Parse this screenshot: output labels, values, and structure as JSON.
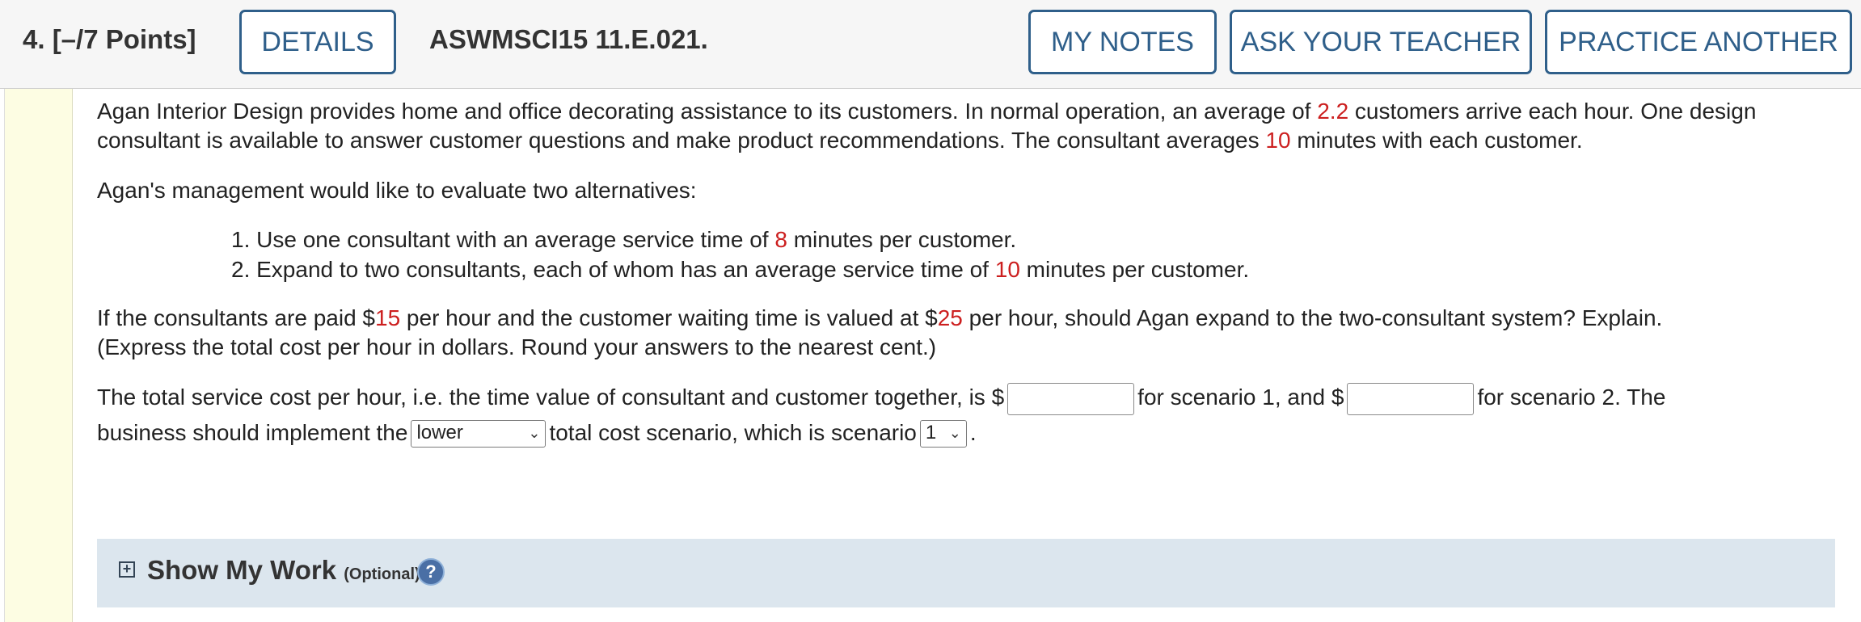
{
  "header": {
    "question_label": "4.  [–/7 Points]",
    "details_label": "DETAILS",
    "problem_code": "ASWMSCI15 11.E.021.",
    "my_notes_label": "MY NOTES",
    "ask_teacher_label": "ASK YOUR TEACHER",
    "practice_another_label": "PRACTICE ANOTHER"
  },
  "body": {
    "p1_a": "Agan Interior Design provides home and office decorating assistance to its customers. In normal operation, an average of ",
    "p1_rate": "2.2",
    "p1_b": " customers arrive each hour. One design consultant is available to answer customer questions and make product recommendations. The consultant averages ",
    "p1_minutes": "10",
    "p1_c": " minutes with each customer.",
    "p2": "Agan's management would like to evaluate two alternatives:",
    "alt1_a": "1. Use one consultant with an average service time of ",
    "alt1_minutes": "8",
    "alt1_b": " minutes per customer.",
    "alt2_a": "2. Expand to two consultants, each of whom has an average service time of ",
    "alt2_minutes": "10",
    "alt2_b": " minutes per customer.",
    "p3_a": "If the consultants are paid $",
    "p3_pay": "15",
    "p3_b": " per hour and the customer waiting time is valued at $",
    "p3_wait": "25",
    "p3_c": " per hour, should Agan expand to the two-consultant system? Explain.",
    "p3_d": "(Express the total cost per hour in dollars. Round your answers to the nearest cent.)",
    "ans_a": "The total service cost per hour, i.e. the time value of consultant and customer together, is $",
    "ans_b": "for scenario 1, and $",
    "ans_c": "for scenario 2. The",
    "ans_d": "business should implement the",
    "ans_e": "total cost scenario, which is scenario",
    "ans_f": ".",
    "select_cost_value": "lower",
    "select_scenario_value": "1",
    "input1_value": "",
    "input2_value": ""
  },
  "show_my_work": {
    "title": "Show My Work",
    "optional": "(Optional)",
    "plus": "+",
    "help": "?"
  },
  "colors": {
    "accent": "#2f5f8a",
    "highlight_red": "#cc1f1f",
    "left_bar": "#fdfde3",
    "show_work_bg": "#dce6ee"
  }
}
